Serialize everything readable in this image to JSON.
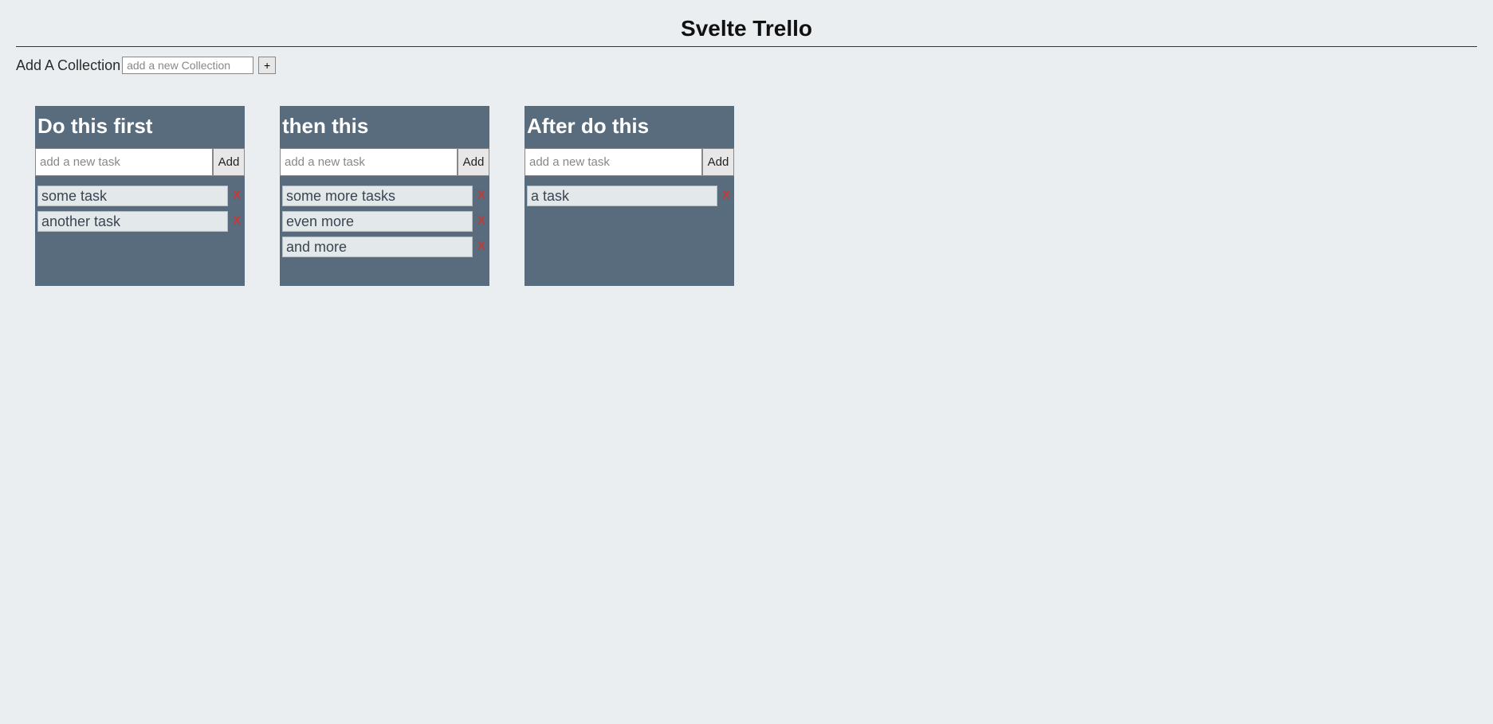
{
  "header": {
    "title": "Svelte Trello"
  },
  "add_collection": {
    "label": "Add A Collection",
    "placeholder": "add a new Collection",
    "button": "+"
  },
  "task_placeholder": "add a new task",
  "add_button_label": "Add",
  "delete_icon": "X",
  "collections": [
    {
      "title": "Do this first",
      "tasks": [
        "some task",
        "another task"
      ]
    },
    {
      "title": "then this",
      "tasks": [
        "some more tasks",
        "even more",
        "and more"
      ]
    },
    {
      "title": "After do this",
      "tasks": [
        "a task"
      ]
    }
  ]
}
